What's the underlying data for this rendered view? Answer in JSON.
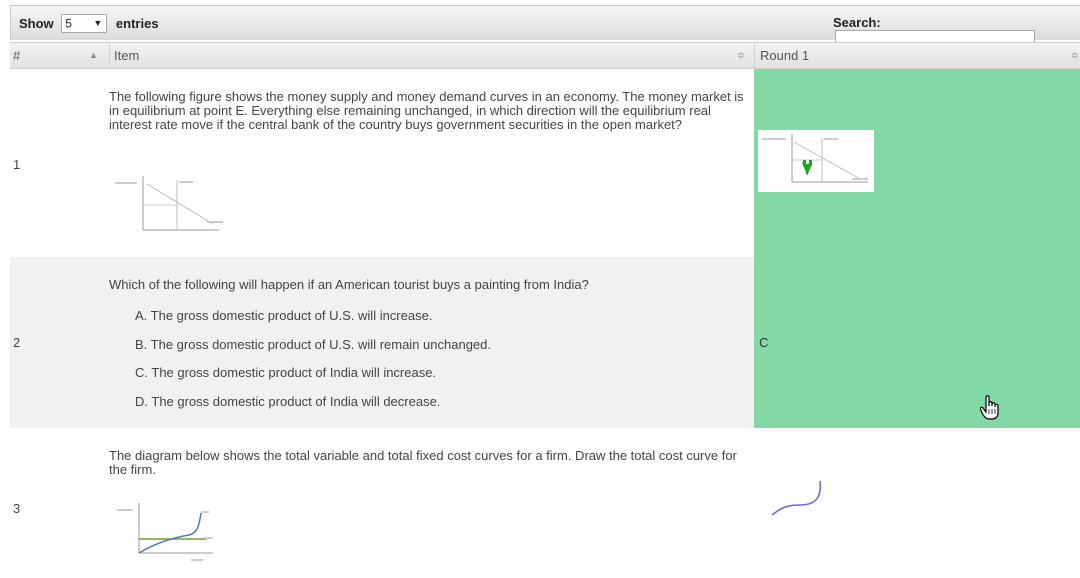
{
  "toolbar": {
    "show_label": "Show",
    "entries_value": "5",
    "entries_label": "entries",
    "search_label": "Search:",
    "search_value": ""
  },
  "columns": [
    "#",
    "Item",
    "Round 1"
  ],
  "rows": [
    {
      "num": "1",
      "question": "The following figure shows the money supply and money demand curves in an economy. The money market is in equilibrium at point E. Everything else remaining unchanged, in which direction will the equilibrium real interest rate move if the central bank of the country buys government securities in the open market?",
      "round1": "",
      "round1_color": "#83d9a5"
    },
    {
      "num": "2",
      "question": "Which of the following will happen if an American tourist buys a painting from India?",
      "options": [
        "A. The gross domestic product of U.S. will increase.",
        "B. The gross domestic product of U.S. will remain unchanged.",
        "C. The gross domestic product of India will increase.",
        "D. The gross domestic product of India will decrease."
      ],
      "round1": "C",
      "round1_color": "#83d9a5"
    },
    {
      "num": "3",
      "question": "The diagram below shows the total variable and total fixed cost curves for a firm. Draw the total cost curve for the firm.",
      "round1": ""
    }
  ]
}
